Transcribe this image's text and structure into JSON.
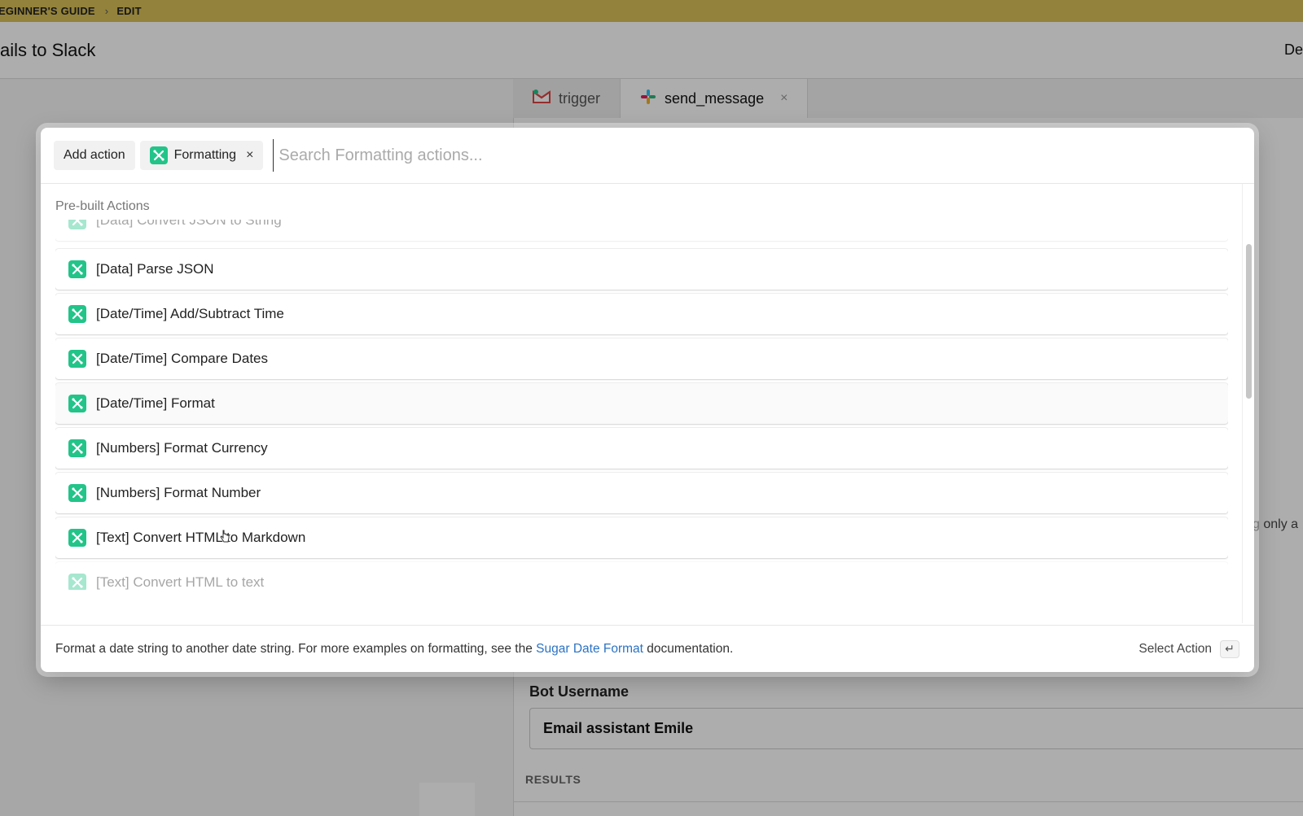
{
  "breadcrumb": {
    "items": [
      "EGINNER'S GUIDE",
      "EDIT"
    ],
    "separator": "›"
  },
  "header": {
    "title": "ails to Slack",
    "right_text": "De"
  },
  "bg_tabs": [
    {
      "label": "trigger",
      "icon": "gmail-icon"
    },
    {
      "label": "send_message",
      "icon": "slack-icon",
      "close": "×"
    }
  ],
  "bot_username": {
    "label": "Bot Username",
    "value": "Email assistant Emile"
  },
  "results_label": "RESULTS",
  "side_text": "g only a",
  "modal": {
    "add_action_label": "Add action",
    "filter_chip": {
      "label": "Formatting",
      "icon": "formatting-icon",
      "close": "×"
    },
    "search": {
      "value": "",
      "placeholder": "Search Formatting actions..."
    },
    "section_label": "Pre-built Actions",
    "items": [
      {
        "label": "[Data] Convert JSON to String"
      },
      {
        "label": "[Data] Parse JSON"
      },
      {
        "label": "[Date/Time] Add/Subtract Time"
      },
      {
        "label": "[Date/Time] Compare Dates"
      },
      {
        "label": "[Date/Time] Format"
      },
      {
        "label": "[Numbers] Format Currency"
      },
      {
        "label": "[Numbers] Format Number"
      },
      {
        "label": "[Text] Convert HTML to Markdown"
      },
      {
        "label": "[Text] Convert HTML to text"
      }
    ],
    "footer": {
      "desc_before": "Format a date string to another date string. For more examples on formatting, see the ",
      "link_text": "Sugar Date Format",
      "desc_after": " documentation.",
      "select_action_label": "Select Action",
      "enter_key": "↵"
    }
  },
  "colors": {
    "accent_green": "#22c489",
    "link_blue": "#2a72c4",
    "topbar": "#d9c058"
  }
}
